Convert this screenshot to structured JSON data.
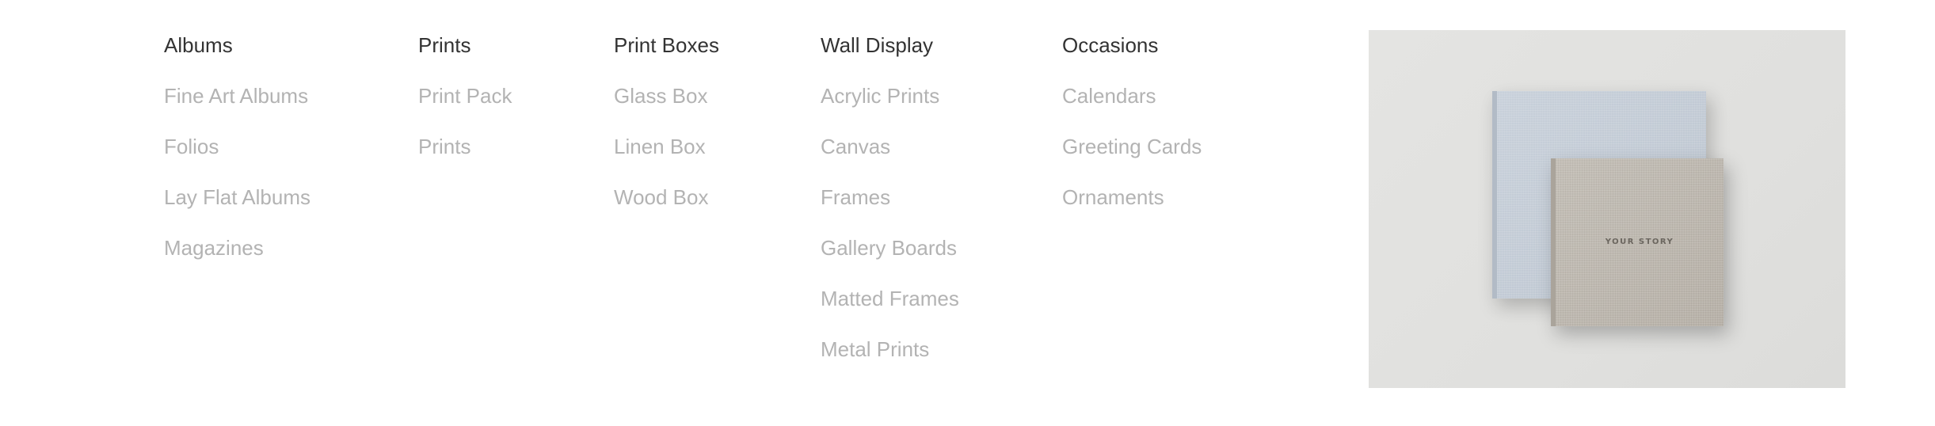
{
  "menu": {
    "columns": [
      {
        "heading": "Albums",
        "items": [
          "Fine Art Albums",
          "Folios",
          "Lay Flat Albums",
          "Magazines"
        ]
      },
      {
        "heading": "Prints",
        "items": [
          "Print Pack",
          "Prints"
        ]
      },
      {
        "heading": "Print Boxes",
        "items": [
          "Glass Box",
          "Linen Box",
          "Wood Box"
        ]
      },
      {
        "heading": "Wall Display",
        "items": [
          "Acrylic Prints",
          "Canvas",
          "Frames",
          "Gallery Boards",
          "Matted Frames",
          "Metal Prints"
        ]
      },
      {
        "heading": "Occasions",
        "items": [
          "Calendars",
          "Greeting Cards",
          "Ornaments"
        ]
      }
    ]
  },
  "promo": {
    "book_title": "YOUR STORY"
  },
  "colors": {
    "heading": "#333333",
    "link": "#b3b3b3",
    "promo_background": "#e2e2e0",
    "book_blue": "#c2cad4",
    "book_linen": "#bcb6ad"
  }
}
